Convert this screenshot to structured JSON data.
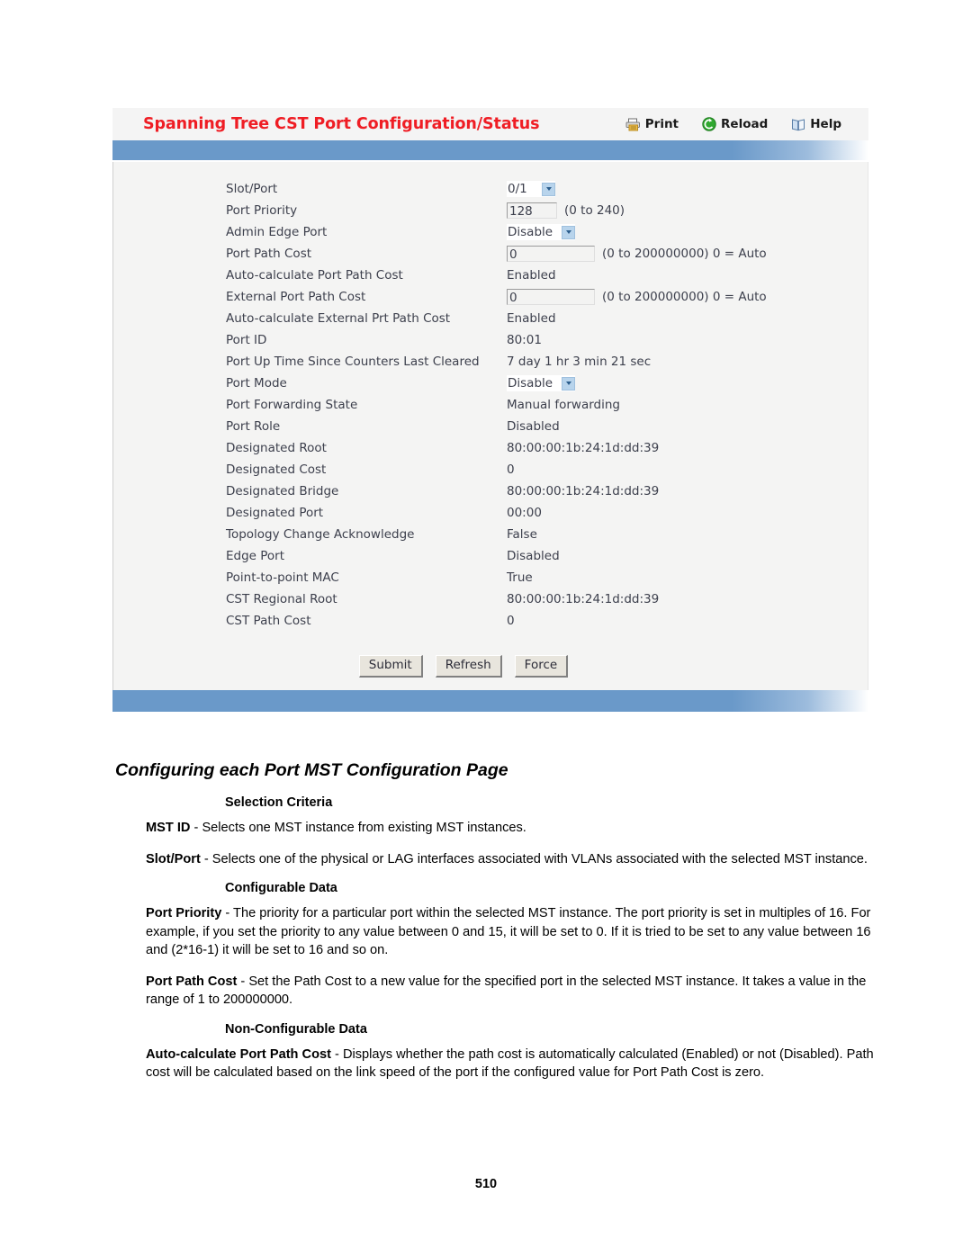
{
  "screenshot": {
    "title": "Spanning Tree CST Port Configuration/Status",
    "tools": [
      {
        "label": "Print",
        "icon": "printer-icon"
      },
      {
        "label": "Reload",
        "icon": "reload-icon"
      },
      {
        "label": "Help",
        "icon": "help-book-icon"
      }
    ],
    "accent_band_color": "#6a99c9",
    "title_color": "#ef1d24",
    "rows": [
      {
        "label": "Slot/Port",
        "type": "select",
        "value": "0/1"
      },
      {
        "label": "Port Priority",
        "type": "text",
        "value": "128",
        "hint": "(0 to 240)",
        "width": "small"
      },
      {
        "label": "Admin Edge Port",
        "type": "select",
        "value": "Disable"
      },
      {
        "label": "Port Path Cost",
        "type": "text",
        "value": "0",
        "hint": "(0 to 200000000) 0 = Auto",
        "width": "wide"
      },
      {
        "label": "Auto-calculate Port Path Cost",
        "type": "static",
        "value": "Enabled"
      },
      {
        "label": "External Port Path Cost",
        "type": "text",
        "value": "0",
        "hint": "(0 to 200000000) 0 = Auto",
        "width": "wide"
      },
      {
        "label": "Auto-calculate External Prt Path Cost",
        "type": "static",
        "value": "Enabled"
      },
      {
        "label": "Port ID",
        "type": "static",
        "value": "80:01"
      },
      {
        "label": "Port Up Time Since Counters Last Cleared",
        "type": "static",
        "value": "7 day 1 hr 3 min 21 sec"
      },
      {
        "label": "Port Mode",
        "type": "select",
        "value": "Disable"
      },
      {
        "label": "Port Forwarding State",
        "type": "static",
        "value": "Manual forwarding"
      },
      {
        "label": "Port Role",
        "type": "static",
        "value": "Disabled"
      },
      {
        "label": "Designated Root",
        "type": "static",
        "value": "80:00:00:1b:24:1d:dd:39"
      },
      {
        "label": "Designated Cost",
        "type": "static",
        "value": "0"
      },
      {
        "label": "Designated Bridge",
        "type": "static",
        "value": "80:00:00:1b:24:1d:dd:39"
      },
      {
        "label": "Designated Port",
        "type": "static",
        "value": "00:00"
      },
      {
        "label": "Topology Change Acknowledge",
        "type": "static",
        "value": "False"
      },
      {
        "label": "Edge Port",
        "type": "static",
        "value": "Disabled"
      },
      {
        "label": "Point-to-point MAC",
        "type": "static",
        "value": "True"
      },
      {
        "label": "CST Regional Root",
        "type": "static",
        "value": "80:00:00:1b:24:1d:dd:39"
      },
      {
        "label": "CST Path Cost",
        "type": "static",
        "value": "0"
      }
    ],
    "buttons": [
      {
        "label": "Submit"
      },
      {
        "label": "Refresh"
      },
      {
        "label": "Force"
      }
    ]
  },
  "document": {
    "heading": "Configuring each Port MST Configuration Page",
    "section_selection_criteria": "Selection Criteria",
    "mst_id_term": "MST ID",
    "mst_id_text": " - Selects one MST instance from existing MST instances.",
    "slot_port_term": "Slot/Port",
    "slot_port_text": " - Selects one of the physical or LAG interfaces associated with VLANs associated with the selected MST instance.",
    "section_configurable_data": "Configurable Data",
    "port_priority_term": "Port Priority",
    "port_priority_text": " - The priority for a particular port within the selected MST instance. The port priority is set in multiples of 16. For example, if you set the priority to any value between 0 and 15, it will be set to 0. If it is tried to be set to any value between 16 and (2*16-1) it will be set to 16 and so on.",
    "port_path_cost_term": "Port Path Cost",
    "port_path_cost_text": " - Set the Path Cost to a new value for the specified port in the selected MST instance. It takes a value in the range of 1 to 200000000.",
    "section_non_configurable_data": "Non-Configurable Data",
    "auto_calc_term": "Auto-calculate Port Path Cost",
    "auto_calc_text": " - Displays whether the path cost is automatically calculated (Enabled) or not (Disabled). Path cost will be calculated based on the link speed of the port if the configured value for Port Path Cost is zero.",
    "page_number": "510"
  }
}
